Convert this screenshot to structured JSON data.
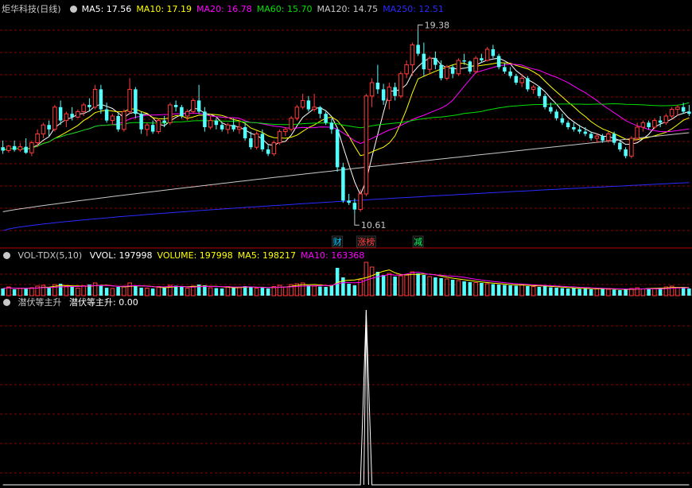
{
  "panel1": {
    "title": "炬华科技(日线)",
    "ma": [
      {
        "label": "MA5: 17.56",
        "color": "#ffffff"
      },
      {
        "label": "MA10: 17.19",
        "color": "#ffff00"
      },
      {
        "label": "MA20: 16.78",
        "color": "#ff00ff"
      },
      {
        "label": "MA60: 15.70",
        "color": "#00e000"
      },
      {
        "label": "MA120: 14.75",
        "color": "#c8c8c8"
      },
      {
        "label": "MA250: 12.51",
        "color": "#2a2aff"
      }
    ],
    "high_label": "19.38",
    "low_label": "10.61",
    "markers": [
      {
        "text": "财",
        "color": "#00ccff",
        "idx": 58
      },
      {
        "text": "涨榜",
        "color": "#ff4040",
        "idx": 63
      },
      {
        "text": "减",
        "color": "#00ff60",
        "idx": 72
      }
    ]
  },
  "panel2": {
    "name": "VOL-TDX(5,10)",
    "items": [
      {
        "label": "VVOL: 197998",
        "color": "#ffffff"
      },
      {
        "label": "VOLUME: 197998",
        "color": "#ffff00"
      },
      {
        "label": "MA5: 198217",
        "color": "#ffff00"
      },
      {
        "label": "MA10: 163368",
        "color": "#ff00ff"
      }
    ]
  },
  "panel3": {
    "name": "潜伏等主升",
    "value_label": "潜伏等主升: 0.00",
    "peak_idx": 63
  },
  "colors": {
    "up": "#ff3c3c",
    "down": "#54ffff",
    "grid": "#8b0000",
    "bg": "#000000"
  },
  "chart_data": {
    "type": "candlestick",
    "ohlc": [
      [
        14.1,
        14.4,
        13.8,
        13.95
      ],
      [
        13.95,
        14.2,
        13.85,
        14.15
      ],
      [
        14.15,
        14.4,
        13.9,
        13.98
      ],
      [
        13.98,
        14.3,
        13.9,
        14.12
      ],
      [
        14.12,
        14.5,
        13.8,
        13.85
      ],
      [
        13.85,
        14.4,
        13.7,
        14.3
      ],
      [
        14.3,
        14.9,
        14.1,
        14.7
      ],
      [
        14.7,
        15.2,
        14.5,
        15.1
      ],
      [
        15.1,
        15.3,
        14.6,
        14.9
      ],
      [
        14.9,
        16.0,
        14.8,
        15.9
      ],
      [
        15.9,
        16.2,
        15.1,
        15.3
      ],
      [
        15.3,
        15.7,
        15.0,
        15.6
      ],
      [
        15.6,
        15.9,
        15.3,
        15.45
      ],
      [
        15.45,
        15.8,
        15.4,
        15.7
      ],
      [
        15.7,
        16.1,
        15.5,
        16.0
      ],
      [
        16.0,
        16.3,
        15.7,
        15.9
      ],
      [
        15.9,
        16.9,
        15.8,
        16.7
      ],
      [
        16.7,
        16.9,
        15.6,
        15.8
      ],
      [
        15.8,
        16.1,
        15.2,
        15.3
      ],
      [
        15.3,
        15.6,
        15.1,
        15.5
      ],
      [
        15.5,
        15.6,
        14.8,
        14.9
      ],
      [
        14.9,
        15.8,
        14.8,
        15.7
      ],
      [
        15.7,
        17.2,
        15.6,
        16.7
      ],
      [
        16.7,
        16.8,
        15.4,
        15.6
      ],
      [
        15.6,
        15.7,
        14.7,
        14.9
      ],
      [
        14.9,
        15.2,
        14.6,
        15.1
      ],
      [
        15.1,
        15.3,
        14.7,
        14.8
      ],
      [
        14.8,
        15.4,
        14.7,
        15.3
      ],
      [
        15.3,
        15.5,
        15.0,
        15.2
      ],
      [
        15.2,
        16.1,
        15.1,
        16.0
      ],
      [
        16.0,
        16.2,
        15.7,
        15.9
      ],
      [
        15.9,
        16.0,
        15.4,
        15.5
      ],
      [
        15.5,
        15.8,
        15.3,
        15.7
      ],
      [
        15.7,
        16.3,
        15.6,
        16.2
      ],
      [
        16.2,
        16.9,
        15.6,
        15.7
      ],
      [
        15.7,
        15.9,
        14.8,
        15.0
      ],
      [
        15.0,
        15.5,
        14.9,
        15.3
      ],
      [
        15.3,
        15.4,
        14.9,
        15.1
      ],
      [
        15.1,
        15.2,
        14.8,
        14.9
      ],
      [
        14.9,
        15.2,
        14.7,
        15.1
      ],
      [
        15.1,
        15.4,
        14.8,
        14.9
      ],
      [
        14.9,
        15.3,
        14.7,
        15.0
      ],
      [
        15.0,
        15.2,
        14.4,
        14.5
      ],
      [
        14.5,
        14.8,
        14.0,
        14.1
      ],
      [
        14.1,
        14.8,
        14.0,
        14.7
      ],
      [
        14.7,
        14.9,
        13.9,
        14.0
      ],
      [
        14.0,
        14.2,
        13.7,
        13.8
      ],
      [
        13.8,
        14.4,
        13.7,
        14.3
      ],
      [
        14.3,
        14.9,
        14.2,
        14.8
      ],
      [
        14.8,
        15.0,
        14.6,
        14.9
      ],
      [
        14.9,
        15.5,
        14.8,
        15.4
      ],
      [
        15.4,
        16.0,
        15.3,
        15.9
      ],
      [
        15.9,
        16.5,
        15.8,
        16.2
      ],
      [
        16.2,
        16.4,
        15.7,
        15.8
      ],
      [
        15.8,
        16.5,
        15.7,
        15.9
      ],
      [
        15.9,
        15.95,
        15.4,
        15.6
      ],
      [
        15.6,
        15.7,
        15.1,
        15.2
      ],
      [
        15.2,
        15.4,
        14.7,
        14.9
      ],
      [
        14.9,
        15.0,
        13.0,
        13.2
      ],
      [
        13.2,
        13.4,
        11.6,
        11.7
      ],
      [
        11.7,
        12.0,
        11.5,
        11.6
      ],
      [
        11.6,
        11.8,
        11.1,
        11.3
      ],
      [
        11.3,
        12.2,
        11.2,
        12.0
      ],
      [
        12.0,
        16.5,
        11.9,
        16.4
      ],
      [
        16.4,
        17.2,
        15.9,
        17.0
      ],
      [
        17.0,
        17.8,
        16.5,
        16.7
      ],
      [
        16.7,
        16.95,
        16.0,
        16.2
      ],
      [
        16.2,
        17.0,
        15.8,
        16.8
      ],
      [
        16.8,
        17.0,
        16.2,
        16.4
      ],
      [
        16.4,
        17.5,
        16.3,
        17.4
      ],
      [
        17.4,
        18.0,
        17.2,
        17.8
      ],
      [
        17.8,
        18.8,
        17.3,
        18.7
      ],
      [
        18.7,
        19.38,
        18.2,
        18.3
      ],
      [
        18.3,
        18.8,
        17.3,
        17.6
      ],
      [
        17.6,
        18.2,
        17.4,
        18.1
      ],
      [
        18.1,
        18.4,
        17.6,
        17.8
      ],
      [
        17.8,
        18.0,
        17.1,
        17.2
      ],
      [
        17.2,
        17.8,
        17.1,
        17.7
      ],
      [
        17.7,
        17.8,
        17.2,
        17.4
      ],
      [
        17.4,
        18.1,
        17.3,
        18.0
      ],
      [
        18.0,
        18.3,
        17.8,
        17.95
      ],
      [
        17.95,
        18.0,
        17.4,
        17.5
      ],
      [
        17.5,
        18.2,
        17.4,
        18.1
      ],
      [
        18.1,
        18.3,
        17.9,
        18.0
      ],
      [
        18.0,
        18.6,
        17.95,
        18.5
      ],
      [
        18.5,
        18.7,
        18.1,
        18.2
      ],
      [
        18.2,
        18.3,
        17.6,
        17.7
      ],
      [
        17.7,
        17.9,
        17.4,
        17.5
      ],
      [
        17.5,
        17.7,
        17.2,
        17.3
      ],
      [
        17.3,
        17.4,
        16.9,
        17.0
      ],
      [
        17.0,
        17.4,
        16.8,
        17.2
      ],
      [
        17.2,
        17.3,
        16.6,
        16.7
      ],
      [
        16.7,
        16.9,
        16.5,
        16.8
      ],
      [
        16.8,
        16.85,
        16.3,
        16.4
      ],
      [
        16.4,
        16.5,
        15.8,
        15.9
      ],
      [
        15.9,
        16.1,
        15.6,
        15.7
      ],
      [
        15.7,
        15.8,
        15.3,
        15.4
      ],
      [
        15.4,
        15.6,
        15.1,
        15.2
      ],
      [
        15.2,
        15.3,
        14.9,
        15.0
      ],
      [
        15.0,
        15.2,
        14.8,
        14.9
      ],
      [
        14.9,
        15.1,
        14.7,
        14.8
      ],
      [
        14.8,
        15.0,
        14.6,
        14.7
      ],
      [
        14.7,
        14.8,
        14.4,
        14.5
      ],
      [
        14.5,
        14.7,
        14.3,
        14.6
      ],
      [
        14.6,
        14.7,
        14.3,
        14.4
      ],
      [
        14.4,
        14.8,
        14.3,
        14.7
      ],
      [
        14.7,
        14.8,
        14.2,
        14.3
      ],
      [
        14.3,
        14.4,
        13.9,
        14.0
      ],
      [
        14.0,
        14.1,
        13.6,
        13.7
      ],
      [
        13.7,
        14.6,
        13.6,
        14.5
      ],
      [
        14.5,
        15.2,
        14.4,
        15.0
      ],
      [
        15.0,
        15.3,
        14.8,
        15.2
      ],
      [
        15.2,
        15.3,
        14.9,
        15.0
      ],
      [
        15.0,
        15.4,
        14.9,
        15.3
      ],
      [
        15.3,
        15.5,
        15.0,
        15.2
      ],
      [
        15.2,
        15.6,
        15.1,
        15.5
      ],
      [
        15.5,
        15.9,
        15.4,
        15.8
      ],
      [
        15.8,
        16.0,
        15.5,
        15.9
      ],
      [
        15.9,
        16.1,
        15.6,
        15.7
      ],
      [
        15.7,
        16.0,
        15.5,
        15.6
      ]
    ],
    "volume": [
      90,
      110,
      80,
      95,
      85,
      100,
      120,
      130,
      100,
      140,
      150,
      120,
      110,
      95,
      125,
      140,
      160,
      130,
      100,
      90,
      110,
      120,
      160,
      130,
      100,
      95,
      90,
      115,
      100,
      130,
      125,
      110,
      95,
      120,
      140,
      130,
      100,
      95,
      90,
      115,
      100,
      105,
      120,
      110,
      95,
      100,
      90,
      115,
      130,
      110,
      140,
      150,
      160,
      130,
      120,
      115,
      110,
      130,
      350,
      230,
      150,
      130,
      200,
      420,
      360,
      300,
      260,
      280,
      240,
      250,
      270,
      300,
      280,
      260,
      240,
      230,
      220,
      210,
      200,
      190,
      180,
      170,
      165,
      160,
      150,
      145,
      140,
      135,
      130,
      125,
      140,
      120,
      115,
      110,
      130,
      105,
      100,
      95,
      90,
      100,
      85,
      90,
      80,
      85,
      95,
      80,
      75,
      70,
      80,
      90,
      100,
      85,
      95,
      90,
      100,
      110,
      120,
      100,
      95,
      90
    ],
    "ylim": [
      10.0,
      20.0
    ],
    "indicator_ylim": [
      0,
      1
    ]
  }
}
